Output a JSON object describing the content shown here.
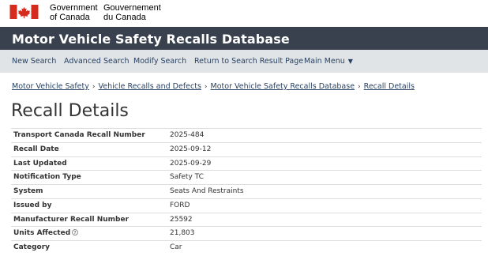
{
  "gov": {
    "en_line1": "Government",
    "en_line2": "of Canada",
    "fr_line1": "Gouvernement",
    "fr_line2": "du Canada"
  },
  "banner": {
    "title": "Motor Vehicle Safety Recalls Database"
  },
  "nav": {
    "items": [
      {
        "label": "New Search"
      },
      {
        "label": "Advanced Search"
      },
      {
        "label": "Modify Search"
      },
      {
        "label": "Return to Search Result Page"
      },
      {
        "label": "Main Menu"
      }
    ],
    "menu_caret_icon": "chevron-down-icon"
  },
  "breadcrumb": {
    "items": [
      {
        "label": "Motor Vehicle Safety"
      },
      {
        "label": "Vehicle Recalls and Defects"
      },
      {
        "label": "Motor Vehicle Safety Recalls Database"
      },
      {
        "label": "Recall Details"
      }
    ],
    "separator": "›"
  },
  "page": {
    "title": "Recall Details"
  },
  "details": [
    {
      "label": "Transport Canada Recall Number",
      "value": "2025-484"
    },
    {
      "label": "Recall Date",
      "value": "2025-09-12"
    },
    {
      "label": "Last Updated",
      "value": "2025-09-29"
    },
    {
      "label": "Notification Type",
      "value": "Safety TC"
    },
    {
      "label": "System",
      "value": "Seats And Restraints"
    },
    {
      "label": "Issued by",
      "value": "FORD"
    },
    {
      "label": "Manufacturer Recall Number",
      "value": "25592"
    },
    {
      "label": "Units Affected",
      "value": "21,803",
      "icon": "help-icon"
    },
    {
      "label": "Category",
      "value": "Car"
    }
  ],
  "colors": {
    "banner_bg": "#38414d",
    "nav_bg": "#e1e4e7",
    "link": "#284162",
    "flag_red": "#d52b1e"
  }
}
